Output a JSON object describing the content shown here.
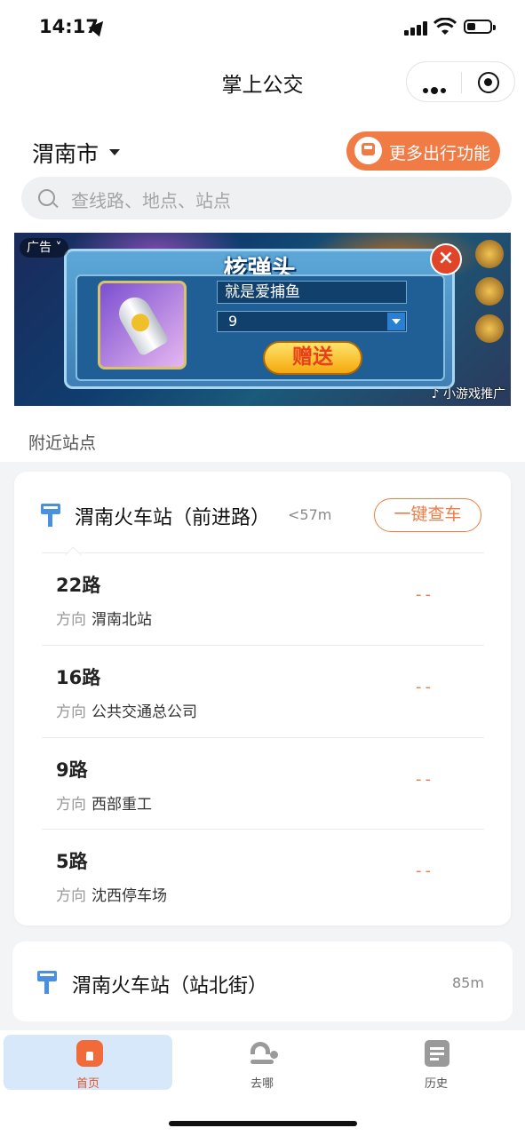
{
  "status_bar": {
    "time": "14:17"
  },
  "header": {
    "title": "掌上公交"
  },
  "city": {
    "name": "渭南市"
  },
  "more_features": {
    "label": "更多出行功能"
  },
  "search": {
    "placeholder": "查线路、地点、站点"
  },
  "ad": {
    "tag": "广告",
    "title": "核弹头",
    "name_field": "就是爱捕鱼",
    "count_value": "9",
    "send_label": "赠送",
    "promo_label": "小游戏推广"
  },
  "nearby": {
    "section_title": "附近站点",
    "stops": [
      {
        "name": "渭南火车站（前进路）",
        "distance": "<57m",
        "check_label": "一键查车",
        "routes": [
          {
            "route": "22路",
            "dir_label": "方向",
            "direction": "渭南北站",
            "eta": "--"
          },
          {
            "route": "16路",
            "dir_label": "方向",
            "direction": "公共交通总公司",
            "eta": "--"
          },
          {
            "route": "9路",
            "dir_label": "方向",
            "direction": "西部重工",
            "eta": "--"
          },
          {
            "route": "5路",
            "dir_label": "方向",
            "direction": "沈西停车场",
            "eta": "--"
          }
        ]
      },
      {
        "name": "渭南火车站（站北街）",
        "distance": "85m"
      }
    ]
  },
  "tabbar": {
    "items": [
      {
        "label": "首页",
        "icon": "home-icon",
        "active": true
      },
      {
        "label": "去哪",
        "icon": "route-icon",
        "active": false
      },
      {
        "label": "历史",
        "icon": "history-icon",
        "active": false
      }
    ]
  },
  "colors": {
    "accent": "#f07b45",
    "stop_icon": "#4a90e2",
    "tab_active_bg": "#d8e8fb"
  }
}
